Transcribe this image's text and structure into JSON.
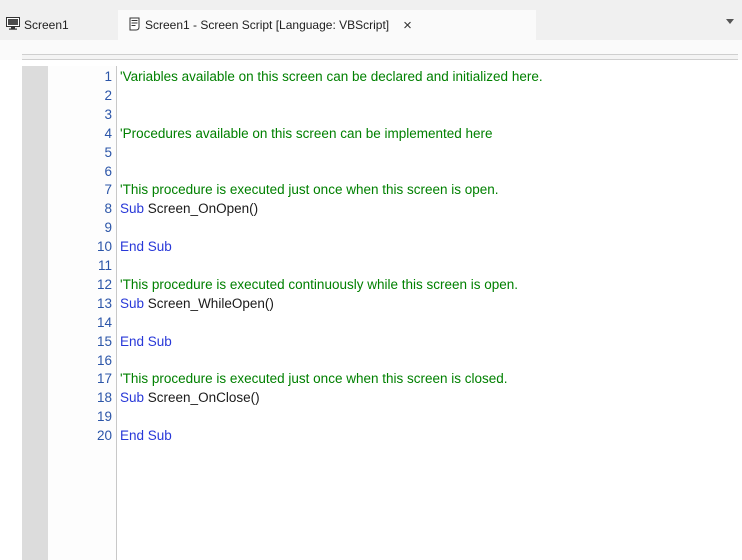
{
  "tabs": [
    {
      "label": "Screen1",
      "icon": "monitor-icon"
    },
    {
      "label": "Screen1 - Screen Script [Language: VBScript]",
      "icon": "script-icon",
      "close": "×"
    }
  ],
  "colors": {
    "comment": "#008000",
    "keyword": "#2838d8",
    "line_number": "#2b55a8",
    "text": "#1a1a1a"
  },
  "editor": {
    "lines": [
      {
        "n": "1",
        "comment": "'Variables available on this screen can be declared and initialized here."
      },
      {
        "n": "2"
      },
      {
        "n": "3"
      },
      {
        "n": "4",
        "comment": "'Procedures available on this screen can be implemented here"
      },
      {
        "n": "5"
      },
      {
        "n": "6"
      },
      {
        "n": "7",
        "comment": "'This procedure is executed just once when this screen is open."
      },
      {
        "n": "8",
        "kw": "Sub",
        "text": " Screen_OnOpen()"
      },
      {
        "n": "9"
      },
      {
        "n": "10",
        "kw": "End Sub"
      },
      {
        "n": "11"
      },
      {
        "n": "12",
        "comment": "'This procedure is executed continuously while this screen is open."
      },
      {
        "n": "13",
        "kw": "Sub",
        "text": " Screen_WhileOpen()"
      },
      {
        "n": "14"
      },
      {
        "n": "15",
        "kw": "End Sub"
      },
      {
        "n": "16"
      },
      {
        "n": "17",
        "comment": "'This procedure is executed just once when this screen is closed."
      },
      {
        "n": "18",
        "kw": "Sub",
        "text": " Screen_OnClose()"
      },
      {
        "n": "19"
      },
      {
        "n": "20",
        "kw": "End Sub"
      }
    ]
  }
}
